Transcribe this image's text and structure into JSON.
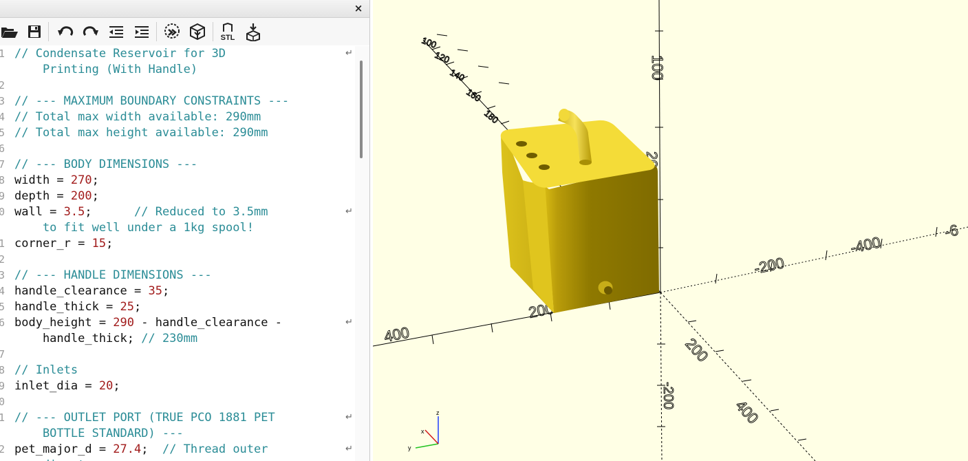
{
  "editor": {
    "close_label": "×",
    "toolbar": {
      "buttons": [
        {
          "name": "open-file-icon"
        },
        {
          "name": "save-icon"
        },
        {
          "name": "undo-icon"
        },
        {
          "name": "redo-icon"
        },
        {
          "name": "unindent-icon"
        },
        {
          "name": "indent-icon"
        },
        {
          "name": "preview-icon"
        },
        {
          "name": "render-icon"
        },
        {
          "name": "export-stl-icon",
          "label": "STL"
        },
        {
          "name": "send-to-print-icon"
        }
      ]
    },
    "lines": [
      {
        "n": "1",
        "wrap": true,
        "segs": [
          {
            "t": "// Condensate Reservoir for 3D",
            "c": "comment"
          }
        ]
      },
      {
        "n": "",
        "segs": [
          {
            "t": "    Printing (With Handle)",
            "c": "comment"
          }
        ]
      },
      {
        "n": "2",
        "segs": []
      },
      {
        "n": "3",
        "segs": [
          {
            "t": "// --- MAXIMUM BOUNDARY CONSTRAINTS ---",
            "c": "comment"
          }
        ]
      },
      {
        "n": "4",
        "segs": [
          {
            "t": "// Total max width available: 290mm",
            "c": "comment"
          }
        ]
      },
      {
        "n": "5",
        "segs": [
          {
            "t": "// Total max height available: 290mm",
            "c": "comment"
          }
        ]
      },
      {
        "n": "6",
        "segs": []
      },
      {
        "n": "7",
        "segs": [
          {
            "t": "// --- BODY DIMENSIONS ---",
            "c": "comment"
          }
        ]
      },
      {
        "n": "8",
        "segs": [
          {
            "t": "width = ",
            "c": "plain"
          },
          {
            "t": "270",
            "c": "num"
          },
          {
            "t": ";",
            "c": "plain"
          }
        ]
      },
      {
        "n": "9",
        "segs": [
          {
            "t": "depth = ",
            "c": "plain"
          },
          {
            "t": "200",
            "c": "num"
          },
          {
            "t": ";",
            "c": "plain"
          }
        ]
      },
      {
        "n": "0",
        "wrap": true,
        "segs": [
          {
            "t": "wall = ",
            "c": "plain"
          },
          {
            "t": "3.5",
            "c": "num"
          },
          {
            "t": ";      ",
            "c": "plain"
          },
          {
            "t": "// Reduced to 3.5mm",
            "c": "comment"
          }
        ]
      },
      {
        "n": "",
        "segs": [
          {
            "t": "    to fit well under a 1kg spool!",
            "c": "comment"
          }
        ]
      },
      {
        "n": "1",
        "segs": [
          {
            "t": "corner_r = ",
            "c": "plain"
          },
          {
            "t": "15",
            "c": "num"
          },
          {
            "t": ";",
            "c": "plain"
          }
        ]
      },
      {
        "n": "2",
        "segs": []
      },
      {
        "n": "3",
        "segs": [
          {
            "t": "// --- HANDLE DIMENSIONS ---",
            "c": "comment"
          }
        ]
      },
      {
        "n": "4",
        "segs": [
          {
            "t": "handle_clearance = ",
            "c": "plain"
          },
          {
            "t": "35",
            "c": "num"
          },
          {
            "t": ";",
            "c": "plain"
          }
        ]
      },
      {
        "n": "5",
        "segs": [
          {
            "t": "handle_thick = ",
            "c": "plain"
          },
          {
            "t": "25",
            "c": "num"
          },
          {
            "t": ";",
            "c": "plain"
          }
        ]
      },
      {
        "n": "6",
        "wrap": true,
        "segs": [
          {
            "t": "body_height = ",
            "c": "plain"
          },
          {
            "t": "290",
            "c": "num"
          },
          {
            "t": " - handle_clearance -",
            "c": "plain"
          }
        ]
      },
      {
        "n": "",
        "segs": [
          {
            "t": "    handle_thick; ",
            "c": "plain"
          },
          {
            "t": "// 230mm",
            "c": "comment"
          }
        ]
      },
      {
        "n": "7",
        "segs": []
      },
      {
        "n": "8",
        "segs": [
          {
            "t": "// Inlets",
            "c": "comment"
          }
        ]
      },
      {
        "n": "9",
        "segs": [
          {
            "t": "inlet_dia = ",
            "c": "plain"
          },
          {
            "t": "20",
            "c": "num"
          },
          {
            "t": ";",
            "c": "plain"
          }
        ]
      },
      {
        "n": "0",
        "segs": []
      },
      {
        "n": "1",
        "wrap": true,
        "segs": [
          {
            "t": "// --- OUTLET PORT (TRUE PCO 1881 PET",
            "c": "comment"
          }
        ]
      },
      {
        "n": "",
        "segs": [
          {
            "t": "    BOTTLE STANDARD) ---",
            "c": "comment"
          }
        ]
      },
      {
        "n": "2",
        "wrap": true,
        "segs": [
          {
            "t": "pet_major_d = ",
            "c": "plain"
          },
          {
            "t": "27.4",
            "c": "num"
          },
          {
            "t": ";  ",
            "c": "plain"
          },
          {
            "t": "// Thread outer",
            "c": "comment"
          }
        ]
      },
      {
        "n": "",
        "segs": [
          {
            "t": "    diameter",
            "c": "comment"
          }
        ]
      }
    ]
  },
  "viewport": {
    "colors": {
      "background": "#ffffe5",
      "model": "#e8cc1c",
      "axis": "#000000"
    },
    "axis_labels": {
      "neg_x_near": [
        "200",
        "400"
      ],
      "pos_x": [
        "-200",
        "-400",
        "-6"
      ],
      "z_up": [
        "100",
        "200"
      ],
      "z_down": [
        "-200"
      ],
      "y_near": [
        "200",
        "400"
      ],
      "y_far": [
        "100",
        "120",
        "140",
        "160",
        "180"
      ]
    },
    "gizmo": {
      "x": "x",
      "y": "y",
      "z": "z"
    }
  }
}
